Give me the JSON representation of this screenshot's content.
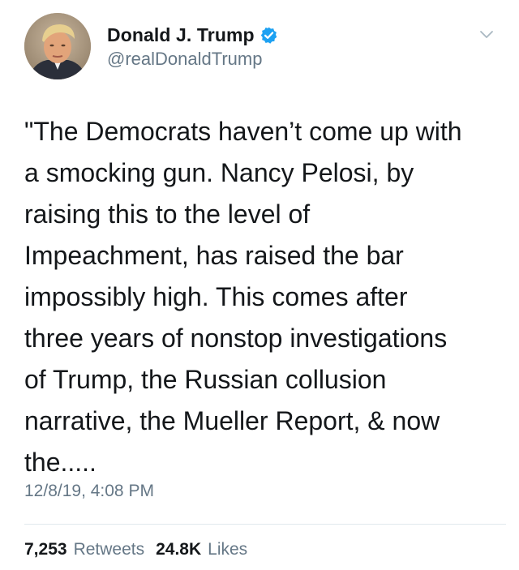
{
  "author": {
    "display_name": "Donald J. Trump",
    "handle": "@realDonaldTrump",
    "verified": true,
    "verified_badge_color": "#1da1f2"
  },
  "tweet": {
    "lines": [
      "\"The Democrats haven’t come up with",
      "a smocking gun. Nancy Pelosi, by",
      "raising this to the level of",
      "Impeachment, has raised the bar",
      "impossibly high. This comes after",
      "three years of nonstop investigations",
      "of Trump, the Russian collusion",
      "narrative, the Mueller Report, & now",
      "the....."
    ],
    "timestamp": "12/8/19, 4:08 PM"
  },
  "stats": {
    "retweets_count": "7,253",
    "retweets_label": "Retweets",
    "likes_count": "24.8K",
    "likes_label": "Likes"
  },
  "icons": {
    "menu": "chevron-down-icon",
    "verified": "verified-badge-icon"
  },
  "colors": {
    "text_primary": "#14171a",
    "text_secondary": "#657786",
    "divider": "#e1e8ed",
    "background": "#ffffff"
  }
}
